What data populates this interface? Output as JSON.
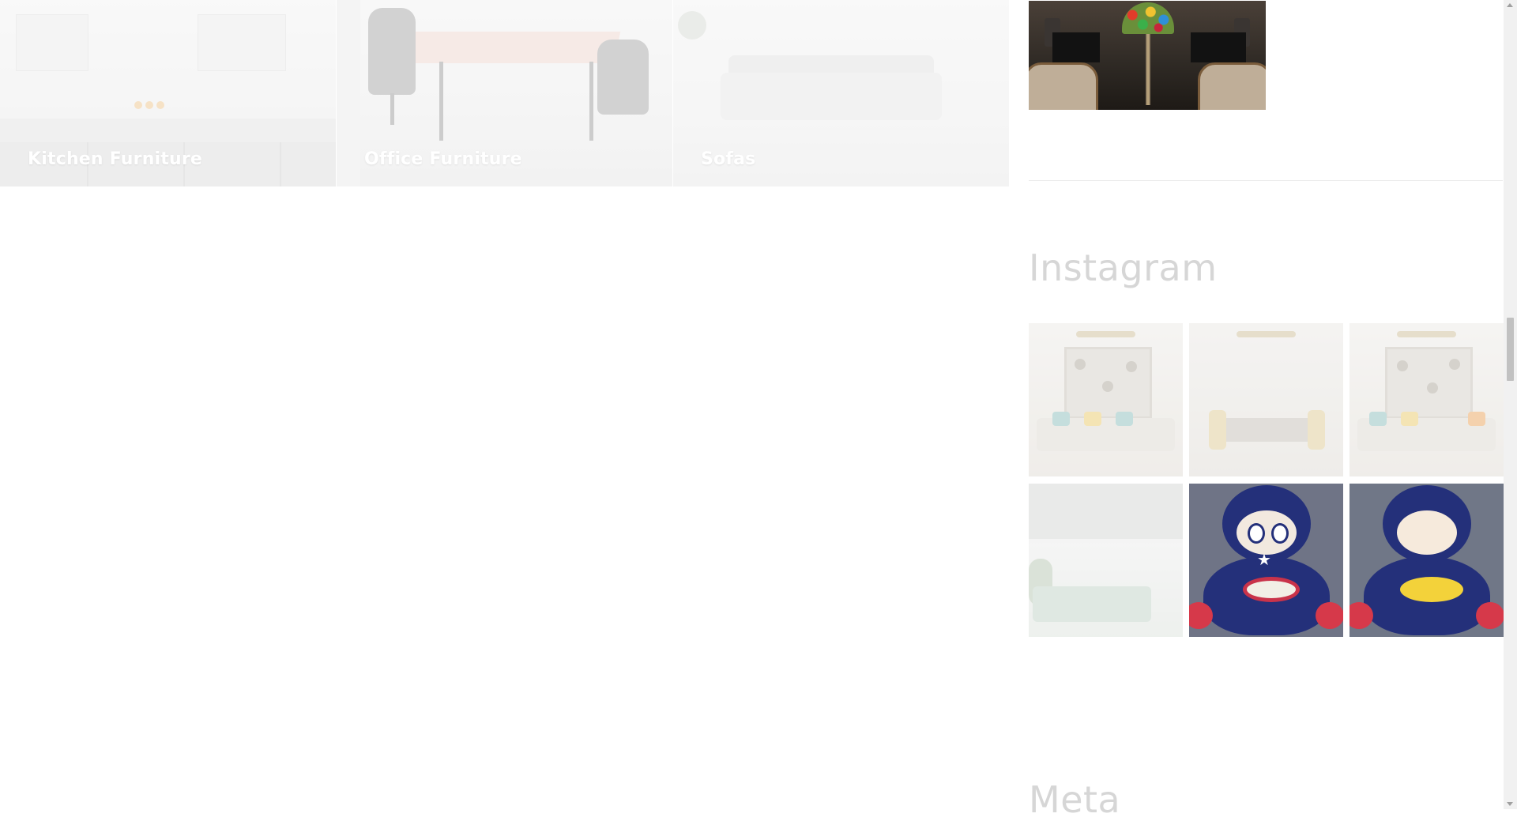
{
  "categories": [
    {
      "label": "Kitchen Furniture"
    },
    {
      "label": "Office Furniture"
    },
    {
      "label": "Sofas"
    }
  ],
  "sidebar": {
    "featured_image": {
      "icon": "tiffany-lamp-photo"
    },
    "instagram": {
      "title": "Instagram",
      "tiles": [
        {
          "icon": "living-room-photo"
        },
        {
          "icon": "dining-room-photo"
        },
        {
          "icon": "living-room-photo"
        },
        {
          "icon": "green-sofa-room-photo"
        },
        {
          "icon": "captain-america-plush-chair-photo"
        },
        {
          "icon": "superman-plush-chair-photo"
        }
      ]
    },
    "meta": {
      "title": "Meta"
    }
  },
  "colors": {
    "widget_title": "#d6d6d6",
    "category_label": "#ffffff",
    "divider": "#ececec"
  }
}
